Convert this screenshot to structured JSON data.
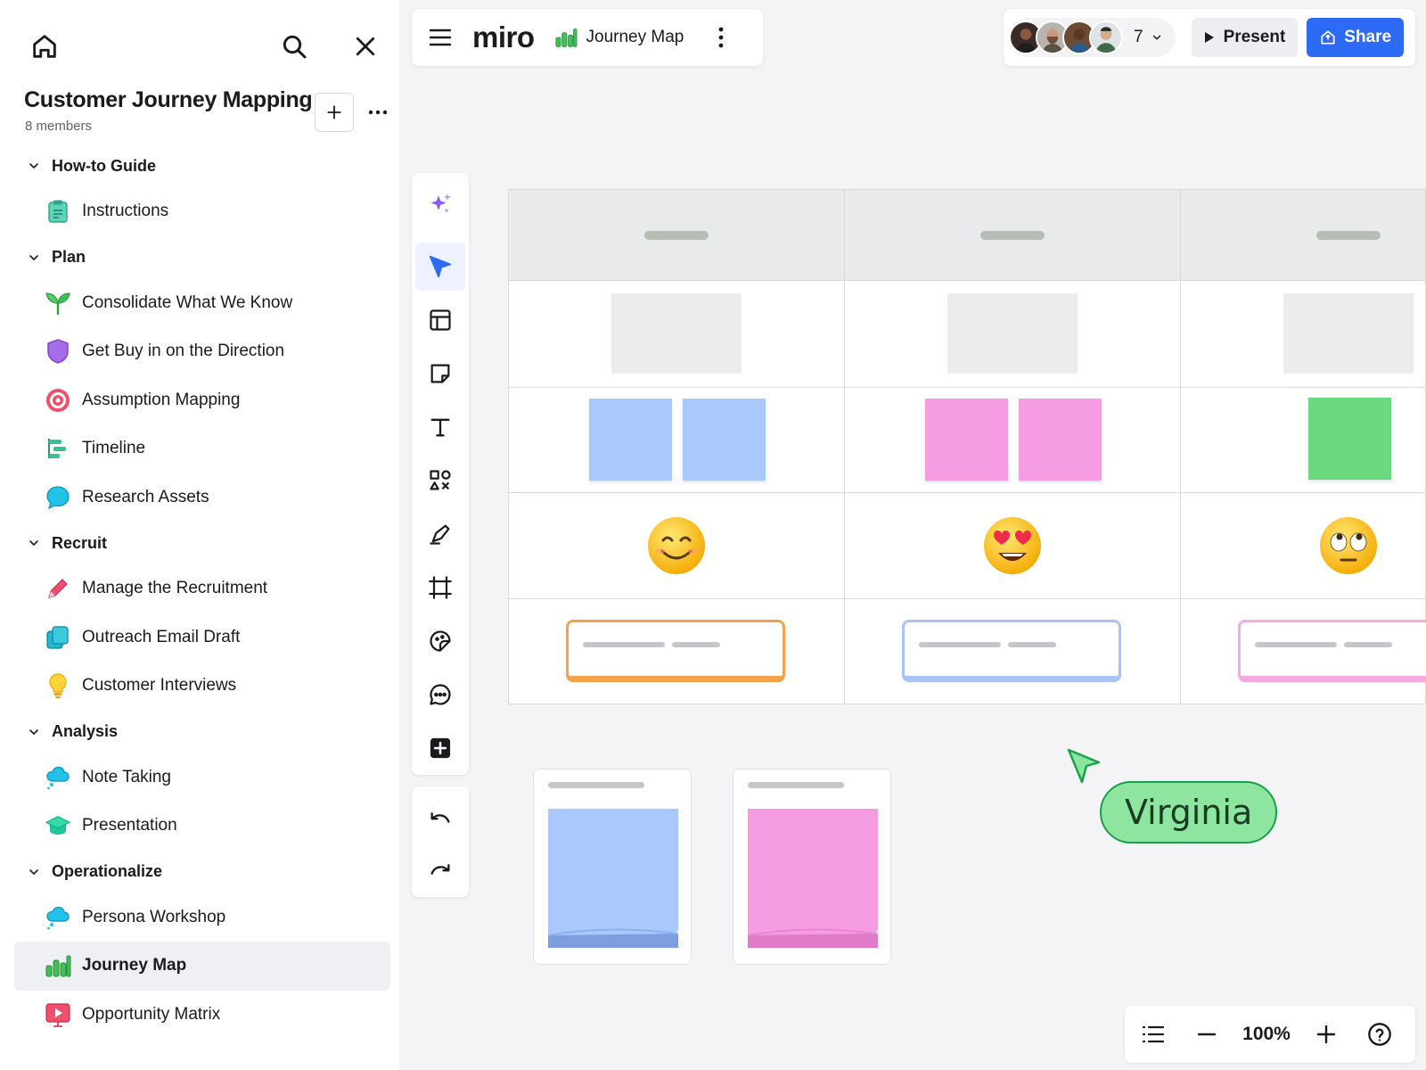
{
  "board": {
    "title": "Customer Journey Mapping",
    "members": "8 members"
  },
  "nav": {
    "sections": [
      {
        "label": "How-to Guide",
        "items": [
          {
            "label": "Instructions",
            "icon": "clipboard-icon"
          }
        ]
      },
      {
        "label": "Plan",
        "items": [
          {
            "label": "Consolidate What We Know",
            "icon": "sprout-icon"
          },
          {
            "label": "Get Buy in on the Direction",
            "icon": "shield-icon"
          },
          {
            "label": "Assumption Mapping",
            "icon": "target-icon"
          },
          {
            "label": "Timeline",
            "icon": "timeline-icon"
          },
          {
            "label": "Research Assets",
            "icon": "speech-bubble-icon"
          }
        ]
      },
      {
        "label": "Recruit",
        "items": [
          {
            "label": "Manage the Recruitment",
            "icon": "pencil-icon"
          },
          {
            "label": "Outreach Email Draft",
            "icon": "copy-icon"
          },
          {
            "label": "Customer Interviews",
            "icon": "lightbulb-icon"
          }
        ]
      },
      {
        "label": "Analysis",
        "items": [
          {
            "label": "Note Taking",
            "icon": "thought-bubble-icon"
          },
          {
            "label": "Presentation",
            "icon": "graduation-cap-icon"
          }
        ]
      },
      {
        "label": "Operationalize",
        "items": [
          {
            "label": "Persona Workshop",
            "icon": "thought-bubble-icon"
          },
          {
            "label": "Journey Map",
            "icon": "bar-chart-icon"
          },
          {
            "label": "Opportunity Matrix",
            "icon": "presentation-icon"
          }
        ]
      }
    ]
  },
  "topbar": {
    "logo": "miro",
    "board_name": "Journey Map",
    "collaborator_count": "7",
    "present_label": "Present",
    "share_label": "Share"
  },
  "canvas": {
    "cursor_name": "Virginia"
  },
  "zoom": {
    "value": "100%"
  },
  "colors": {
    "accent": "#2d6af6",
    "sticky_blue": "#a9c8fb",
    "sticky_pink": "#f69ce2",
    "sticky_green": "#6bd97f",
    "card_orange": "#f7a14a",
    "card_blue": "#a8c3f5",
    "card_pink": "#f7a9e1",
    "cursor_green": "#8ee59f"
  }
}
